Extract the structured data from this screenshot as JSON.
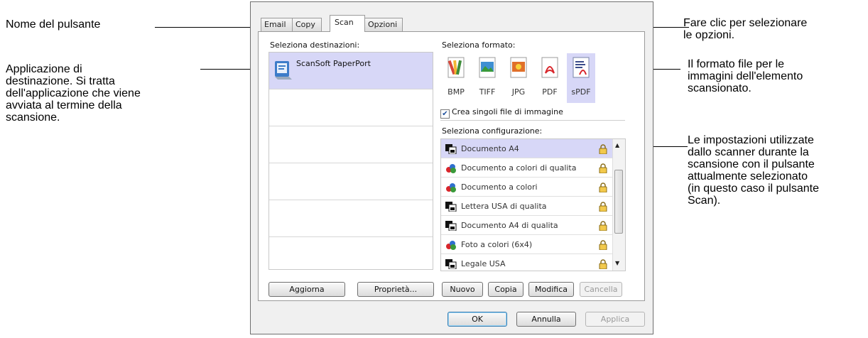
{
  "callouts": {
    "button_name": "Nome del pulsante",
    "destination_app": "Applicazione di\ndestinazione. Si tratta\ndell'applicazione che viene\navviata al termine della\nscansione.",
    "options_click": "Fare clic per selezionare\nle opzioni.",
    "file_format": "Il formato file per le\nimmagini dell'elemento\nscansionato.",
    "settings": "Le impostazioni utilizzate\ndallo scanner durante la\nscansione con il pulsante\nattualmente selezionato\n(in questo caso il pulsante\nScan)."
  },
  "tabs": [
    "Email",
    "Copy",
    "Scan",
    "Opzioni"
  ],
  "active_tab": "Scan",
  "destinations": {
    "label": "Seleziona destinazioni:",
    "items": [
      "ScanSoft PaperPort"
    ]
  },
  "formats": {
    "label": "Seleziona formato:",
    "items": [
      "BMP",
      "TIFF",
      "JPG",
      "PDF",
      "sPDF"
    ],
    "selected": "sPDF",
    "checkbox_label": "Crea singoli file di immagine",
    "checkbox_checked": true
  },
  "configurations": {
    "label": "Seleziona configurazione:",
    "items": [
      {
        "name": "Documento A4",
        "icon": "bw-document-icon"
      },
      {
        "name": "Documento a colori di qualita",
        "icon": "color-document-icon"
      },
      {
        "name": "Documento a colori",
        "icon": "color-document-icon"
      },
      {
        "name": "Lettera USA di qualita",
        "icon": "bw-document-icon"
      },
      {
        "name": "Documento A4 di qualita",
        "icon": "bw-document-icon"
      },
      {
        "name": "Foto a colori (6x4)",
        "icon": "color-document-icon"
      },
      {
        "name": "Legale USA",
        "icon": "bw-document-icon"
      }
    ],
    "selected": "Documento A4"
  },
  "buttons": {
    "refresh": "Aggiorna",
    "properties": "Proprietà...",
    "new": "Nuovo",
    "copy": "Copia",
    "edit": "Modifica",
    "delete": "Cancella",
    "ok": "OK",
    "cancel": "Annulla",
    "apply": "Applica"
  },
  "colors": {
    "selection": "#d7d7f7",
    "default_button_border": "#3c7fb1"
  }
}
